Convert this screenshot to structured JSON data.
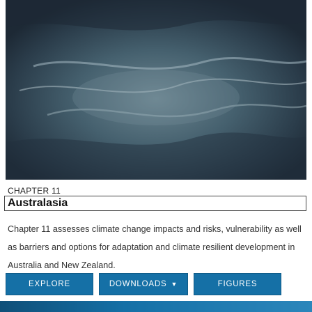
{
  "hero": {
    "image": "sea-waves-photo"
  },
  "chapter_label": "CHAPTER 11",
  "title": "Australasia",
  "description": "Chapter 11 assesses climate change impacts and risks, vulnerability as well as barriers and options for adaptation and climate resilient development in Australia and New Zealand.",
  "buttons": {
    "explore": "EXPLORE",
    "downloads": "DOWNLOADS",
    "figures": "FIGURES"
  },
  "colors": {
    "accent": "#1570a6"
  }
}
